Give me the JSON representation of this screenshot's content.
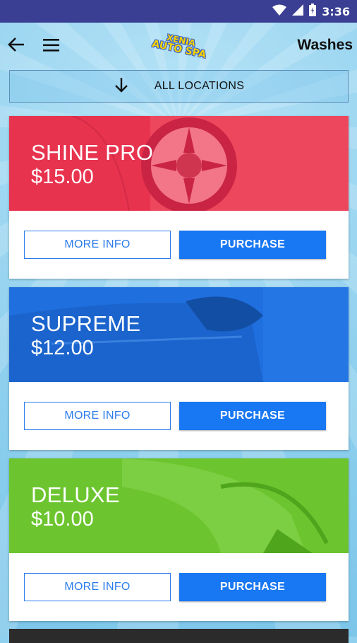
{
  "status_bar": {
    "time": "3:36",
    "icons": [
      "wifi-icon",
      "signal-icon",
      "battery-icon"
    ]
  },
  "app_bar": {
    "logo_line1": "XENIA",
    "logo_line2": "AUTO SPA",
    "title": "Washes",
    "icons": [
      "arrow-left-icon",
      "hamburger-menu-icon"
    ]
  },
  "location_filter": {
    "label": "ALL LOCATIONS",
    "icon": "arrow-down-icon"
  },
  "washes": [
    {
      "name": "SHINE PRO",
      "price": "$15.00",
      "color": "#e8334f",
      "more_info": "MORE INFO",
      "purchase": "PURCHASE"
    },
    {
      "name": "SUPREME",
      "price": "$12.00",
      "color": "#1f6fdf",
      "more_info": "MORE INFO",
      "purchase": "PURCHASE"
    },
    {
      "name": "DELUXE",
      "price": "$10.00",
      "color": "#6cc52f",
      "more_info": "MORE INFO",
      "purchase": "PURCHASE"
    }
  ],
  "colors": {
    "status_bar": "#3a3f93",
    "accent": "#1877f2",
    "background": "#8fd0ee"
  }
}
